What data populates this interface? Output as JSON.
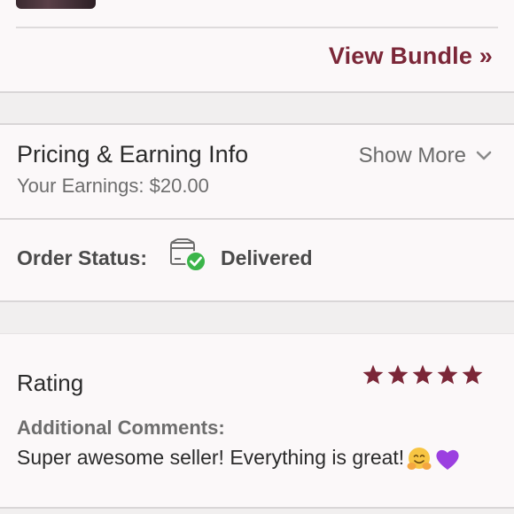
{
  "bundle": {
    "view_bundle_label": "View Bundle »"
  },
  "pricing": {
    "title": "Pricing & Earning Info",
    "earnings_text": "Your Earnings: $20.00",
    "show_more_label": "Show More",
    "chevron_icon": "chevron-down-icon"
  },
  "order": {
    "label": "Order Status:",
    "status": "Delivered",
    "status_icon": "package-delivered-icon",
    "status_color": "#3bb54a"
  },
  "rating": {
    "label": "Rating",
    "stars": 5,
    "max_stars": 5,
    "star_color": "#7b2738",
    "additional_comments_label": "Additional Comments:",
    "comment_text": "Super awesome seller! Everything is great!",
    "comment_emojis": [
      "hugging-face-emoji",
      "purple-heart-emoji"
    ]
  },
  "colors": {
    "accent": "#7b2738",
    "background": "#fbf8f9",
    "band": "#f1efef",
    "divider": "#d9d6d7"
  }
}
